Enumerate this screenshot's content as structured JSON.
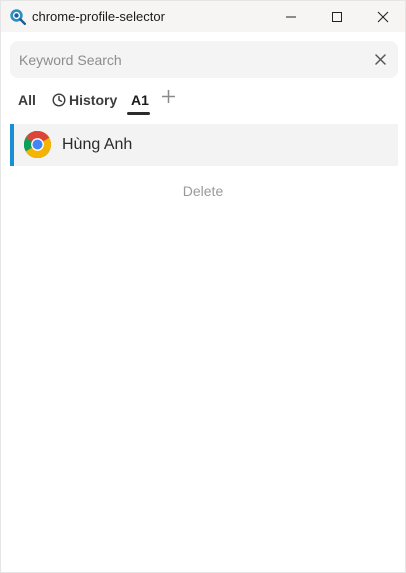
{
  "titlebar": {
    "title": "chrome-profile-selector",
    "icon": "search-globe-icon"
  },
  "search": {
    "placeholder": "Keyword Search",
    "value": ""
  },
  "tabs": [
    {
      "label": "All",
      "active": false
    },
    {
      "label": "History",
      "icon": "clock-icon",
      "active": false
    },
    {
      "label": "A1",
      "active": true
    }
  ],
  "profiles": [
    {
      "name": "Hùng Anh",
      "icon": "chrome-icon",
      "selected": true
    }
  ],
  "actions": {
    "delete_label": "Delete"
  },
  "colors": {
    "accent": "#1a8fd8",
    "titlebar_bg": "#f7f4f4",
    "search_bg": "#f4f4f4",
    "row_bg": "#f3f3f3"
  }
}
